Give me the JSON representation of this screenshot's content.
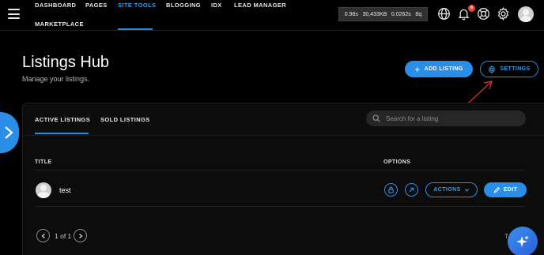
{
  "nav": {
    "items": [
      {
        "label": "DASHBOARD"
      },
      {
        "label": "PAGES"
      },
      {
        "label": "SITE TOOLS"
      },
      {
        "label": "BLOGGING"
      },
      {
        "label": "IDX"
      },
      {
        "label": "LEAD MANAGER"
      },
      {
        "label": "MARKETPLACE"
      }
    ],
    "active": "SITE TOOLS"
  },
  "perf": {
    "time": "0.96s",
    "size": "30,433KB",
    "query_time": "0.0262s",
    "queries": "8q"
  },
  "notifications": {
    "count": "6"
  },
  "header": {
    "title": "Listings Hub",
    "subtitle": "Manage your listings.",
    "add_button": "ADD LISTING",
    "settings_button": "SETTINGS"
  },
  "tabs": [
    {
      "label": "ACTIVE LISTINGS"
    },
    {
      "label": "SOLD LISTINGS"
    }
  ],
  "search": {
    "placeholder": "Search for a listing"
  },
  "table": {
    "columns": {
      "title": "TITLE",
      "options": "OPTIONS"
    },
    "rows": [
      {
        "title": "test",
        "actions_label": "ACTIONS",
        "edit_label": "EDIT"
      }
    ]
  },
  "pagination": {
    "info": "1 of 1"
  },
  "partial_text": "T",
  "colors": {
    "accent": "#2a8ee6",
    "background": "#000000",
    "badge": "#e84343"
  },
  "icons": [
    "menu-icon",
    "globe-icon",
    "bell-icon",
    "help-icon",
    "gear-icon",
    "chevron-right-icon",
    "plus-icon",
    "search-icon",
    "lock-icon",
    "external-link-icon",
    "chevron-down-icon",
    "pencil-icon",
    "sparkle-icon"
  ]
}
